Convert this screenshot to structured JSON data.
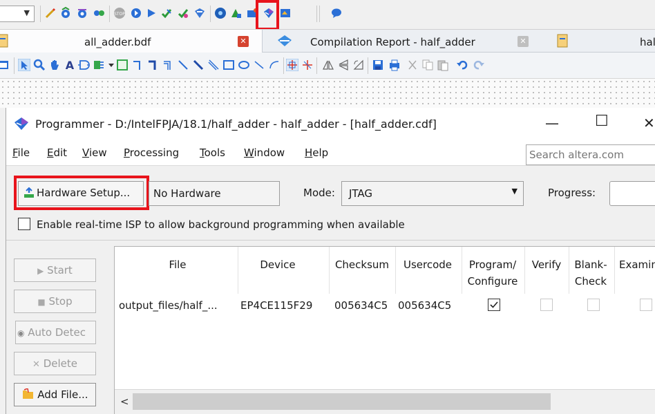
{
  "tabs": [
    {
      "label": "all_adder.bdf"
    },
    {
      "label": "Compilation Report - half_adder"
    },
    {
      "label": "hal"
    }
  ],
  "window": {
    "title": "Programmer - D:/IntelFPJA/18.1/half_adder - half_adder - [half_adder.cdf]",
    "minimize": "—",
    "maximize": "☐",
    "close": "✕"
  },
  "menu": {
    "items": [
      {
        "mnemonic": "F",
        "rest": "ile"
      },
      {
        "mnemonic": "E",
        "rest": "dit"
      },
      {
        "mnemonic": "V",
        "rest": "iew"
      },
      {
        "mnemonic": "P",
        "rest": "rocessing"
      },
      {
        "mnemonic": "T",
        "rest": "ools"
      },
      {
        "mnemonic": "W",
        "rest": "indow"
      },
      {
        "mnemonic": "H",
        "rest": "elp"
      }
    ],
    "search_placeholder": "Search altera.com"
  },
  "hardware": {
    "setup_label": "Hardware Setup...",
    "current": "No Hardware",
    "mode_label": "Mode:",
    "mode_value": "JTAG",
    "progress_label": "Progress:",
    "isp_label": "Enable real-time ISP to allow background programming when available",
    "isp_checked": false
  },
  "side_buttons": {
    "start": "Start",
    "stop": "Stop",
    "auto_detect": "Auto Detec",
    "delete": "Delete",
    "add_file": "Add File..."
  },
  "table": {
    "headers": {
      "file": "File",
      "device": "Device",
      "checksum": "Checksum",
      "usercode": "Usercode",
      "program_1": "Program/",
      "program_2": "Configure",
      "verify": "Verify",
      "blank_1": "Blank-",
      "blank_2": "Check",
      "examine": "Examin"
    },
    "rows": [
      {
        "file": "output_files/half_...",
        "device": "EP4CE115F29",
        "checksum": "005634C5",
        "usercode": "005634C5",
        "program": true,
        "verify": false,
        "blank_check": false,
        "examine": false
      }
    ]
  },
  "highlights": {
    "color": "#e8141c"
  }
}
